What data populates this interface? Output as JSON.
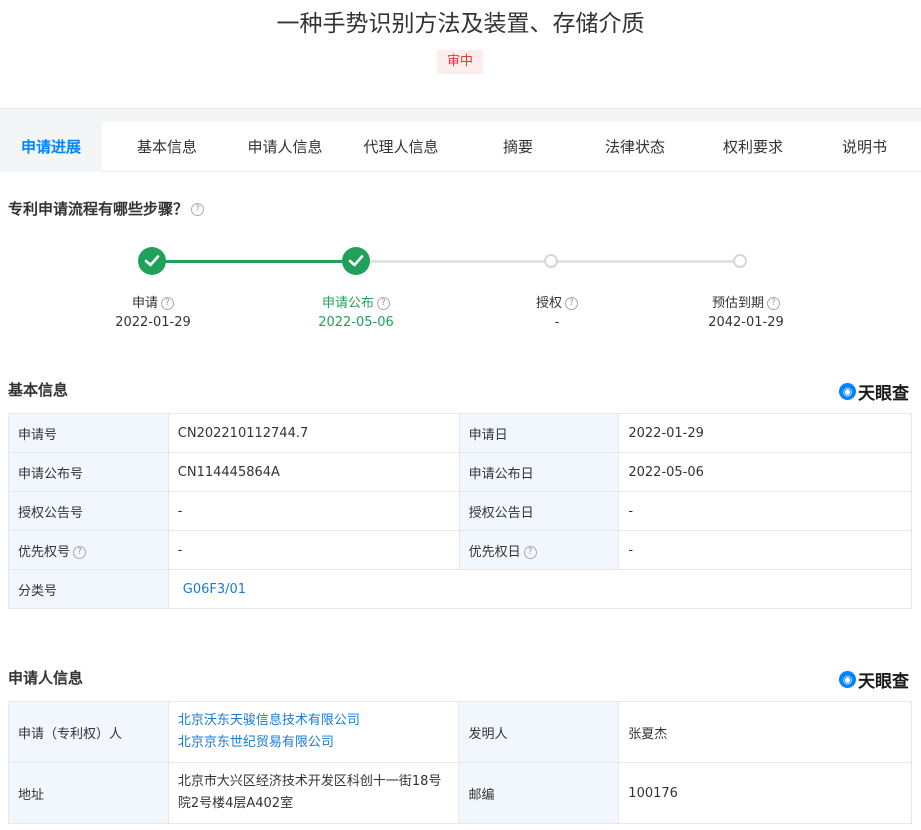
{
  "title": "一种手势识别方法及装置、存储介质",
  "status_badge": "审中",
  "tabs": [
    "申请进展",
    "基本信息",
    "申请人信息",
    "代理人信息",
    "摘要",
    "法律状态",
    "权利要求",
    "说明书"
  ],
  "progress": {
    "heading": "专利申请流程有哪些步骤？",
    "steps": [
      {
        "label": "申请",
        "date": "2022-01-29",
        "done": true
      },
      {
        "label": "申请公布",
        "date": "2022-05-06",
        "done": true
      },
      {
        "label": "授权",
        "date": "-",
        "done": false
      },
      {
        "label": "预估到期",
        "date": "2042-01-29",
        "done": false
      }
    ]
  },
  "brand": "天眼查",
  "basic": {
    "heading": "基本信息",
    "app_no_label": "申请号",
    "app_no": "CN202210112744.7",
    "app_date_label": "申请日",
    "app_date": "2022-01-29",
    "pub_no_label": "申请公布号",
    "pub_no": "CN114445864A",
    "pub_date_label": "申请公布日",
    "pub_date": "2022-05-06",
    "grant_no_label": "授权公告号",
    "grant_no": "-",
    "grant_date_label": "授权公告日",
    "grant_date": "-",
    "priority_no_label": "优先权号",
    "priority_no": "-",
    "priority_date_label": "优先权日",
    "priority_date": "-",
    "class_label": "分类号",
    "class_no": "G06F3/01"
  },
  "applicant": {
    "heading": "申请人信息",
    "holder_label": "申请（专利权）人",
    "holders": [
      "北京沃东天骏信息技术有限公司",
      "北京京东世纪贸易有限公司"
    ],
    "inventor_label": "发明人",
    "inventor": "张夏杰",
    "address_label": "地址",
    "address": "北京市大兴区经济技术开发区科创十一街18号院2号楼4层A402室",
    "postcode_label": "邮编",
    "postcode": "100176"
  },
  "colors": {
    "accent": "#0084ff",
    "done": "#1fa15a",
    "badge": "#e33333"
  }
}
